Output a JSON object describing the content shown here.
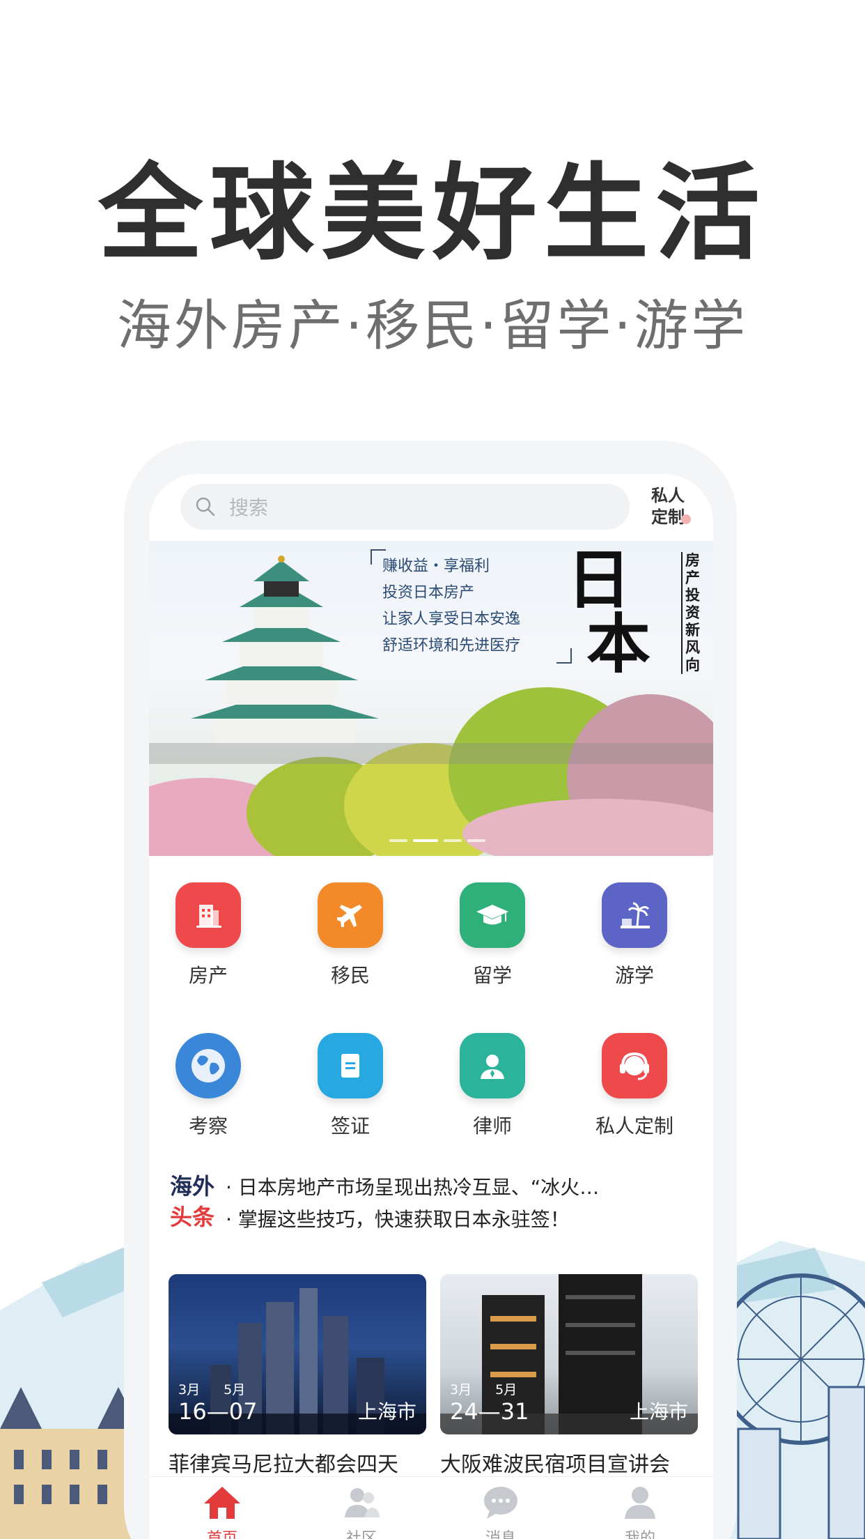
{
  "headline": "全球美好生活",
  "subline": "海外房产·移民·留学·游学",
  "search": {
    "placeholder": "搜索"
  },
  "private_button": {
    "line1": "私人",
    "line2": "定制"
  },
  "banner": {
    "lines": [
      "赚收益・享福利",
      "投资日本房产",
      "让家人享受日本安逸",
      "舒适环境和先进医疗"
    ],
    "big_text": [
      "日",
      "本"
    ],
    "side_text": "房产投资新风向",
    "dots": 4,
    "active_dot": 2
  },
  "grid": [
    {
      "label": "房产",
      "icon": "building-icon",
      "color": "#ee4a4c"
    },
    {
      "label": "移民",
      "icon": "airplane-icon",
      "color": "#f28a2a"
    },
    {
      "label": "留学",
      "icon": "graduation-cap-icon",
      "color": "#2fb07a"
    },
    {
      "label": "游学",
      "icon": "beach-icon",
      "color": "#5c64c6"
    },
    {
      "label": "考察",
      "icon": "globe-icon",
      "color": "#3a86d8"
    },
    {
      "label": "签证",
      "icon": "document-icon",
      "color": "#27a8e0"
    },
    {
      "label": "律师",
      "icon": "lawyer-icon",
      "color": "#2bb39b"
    },
    {
      "label": "私人定制",
      "icon": "headset-icon",
      "color": "#ee4a4c"
    }
  ],
  "news": {
    "logo_line1": "海外",
    "logo_line2": "头条",
    "items": [
      "· 日本房地产市场呈现出热冷互显、“冰火…",
      "· 掌握这些技巧，快速获取日本永驻签！"
    ]
  },
  "cards": [
    {
      "months": "3月 5月",
      "days": "16—07",
      "city": "上海市",
      "title": "菲律宾马尼拉大都会四天"
    },
    {
      "months": "3月 5月",
      "days": "24—31",
      "city": "上海市",
      "title": "大阪难波民宿项目宣讲会"
    }
  ],
  "tabs": [
    {
      "label": "首页",
      "icon": "home-icon",
      "active": true
    },
    {
      "label": "社区",
      "icon": "community-icon",
      "active": false
    },
    {
      "label": "消息",
      "icon": "message-icon",
      "active": false
    },
    {
      "label": "我的",
      "icon": "profile-icon",
      "active": false
    }
  ],
  "colors": {
    "accent": "#e33b3b",
    "text": "#333333",
    "headline": "#2f2f2f"
  }
}
